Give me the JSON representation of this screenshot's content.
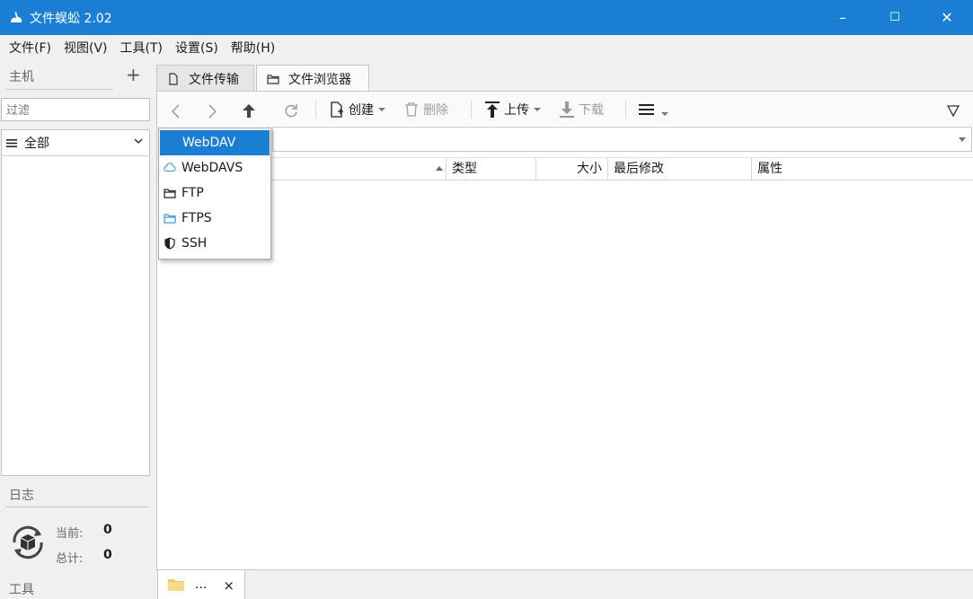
{
  "window": {
    "title": "文件蜈蚣 2.02",
    "controls": {
      "minimize": "–",
      "maximize": "☐",
      "close": "✕"
    }
  },
  "menu": [
    "文件(F)",
    "视图(V)",
    "工具(T)",
    "设置(S)",
    "帮助(H)"
  ],
  "sidebar": {
    "host_header": "主机",
    "add": "+",
    "filter_placeholder": "过滤",
    "group_selected": "全部",
    "log_header": "日志",
    "stats": {
      "current_label": "当前:",
      "current_value": "0",
      "total_label": "总计:",
      "total_value": "0"
    },
    "tools_header": "工具"
  },
  "tabs": [
    {
      "label": "文件传输",
      "active": false
    },
    {
      "label": "文件浏览器",
      "active": true
    }
  ],
  "toolbar": {
    "create": "创建",
    "delete": "删除",
    "upload": "上传",
    "download": "下载"
  },
  "columns": {
    "type": "类型",
    "size": "大小",
    "modified": "最后修改",
    "attrs": "属性"
  },
  "protocol_menu": {
    "selected": "WebDAV",
    "items": [
      {
        "label": "WebDAV",
        "icon": "cloud-icon"
      },
      {
        "label": "WebDAVS",
        "icon": "cloud-icon"
      },
      {
        "label": "FTP",
        "icon": "folder-icon"
      },
      {
        "label": "FTPS",
        "icon": "folder-icon"
      },
      {
        "label": "SSH",
        "icon": "shield-icon"
      }
    ]
  },
  "bottom_tab": {
    "label": "...",
    "close": "×"
  },
  "colors": {
    "accent": "#1a7fd4",
    "titlebar": "#1a7fd4"
  }
}
